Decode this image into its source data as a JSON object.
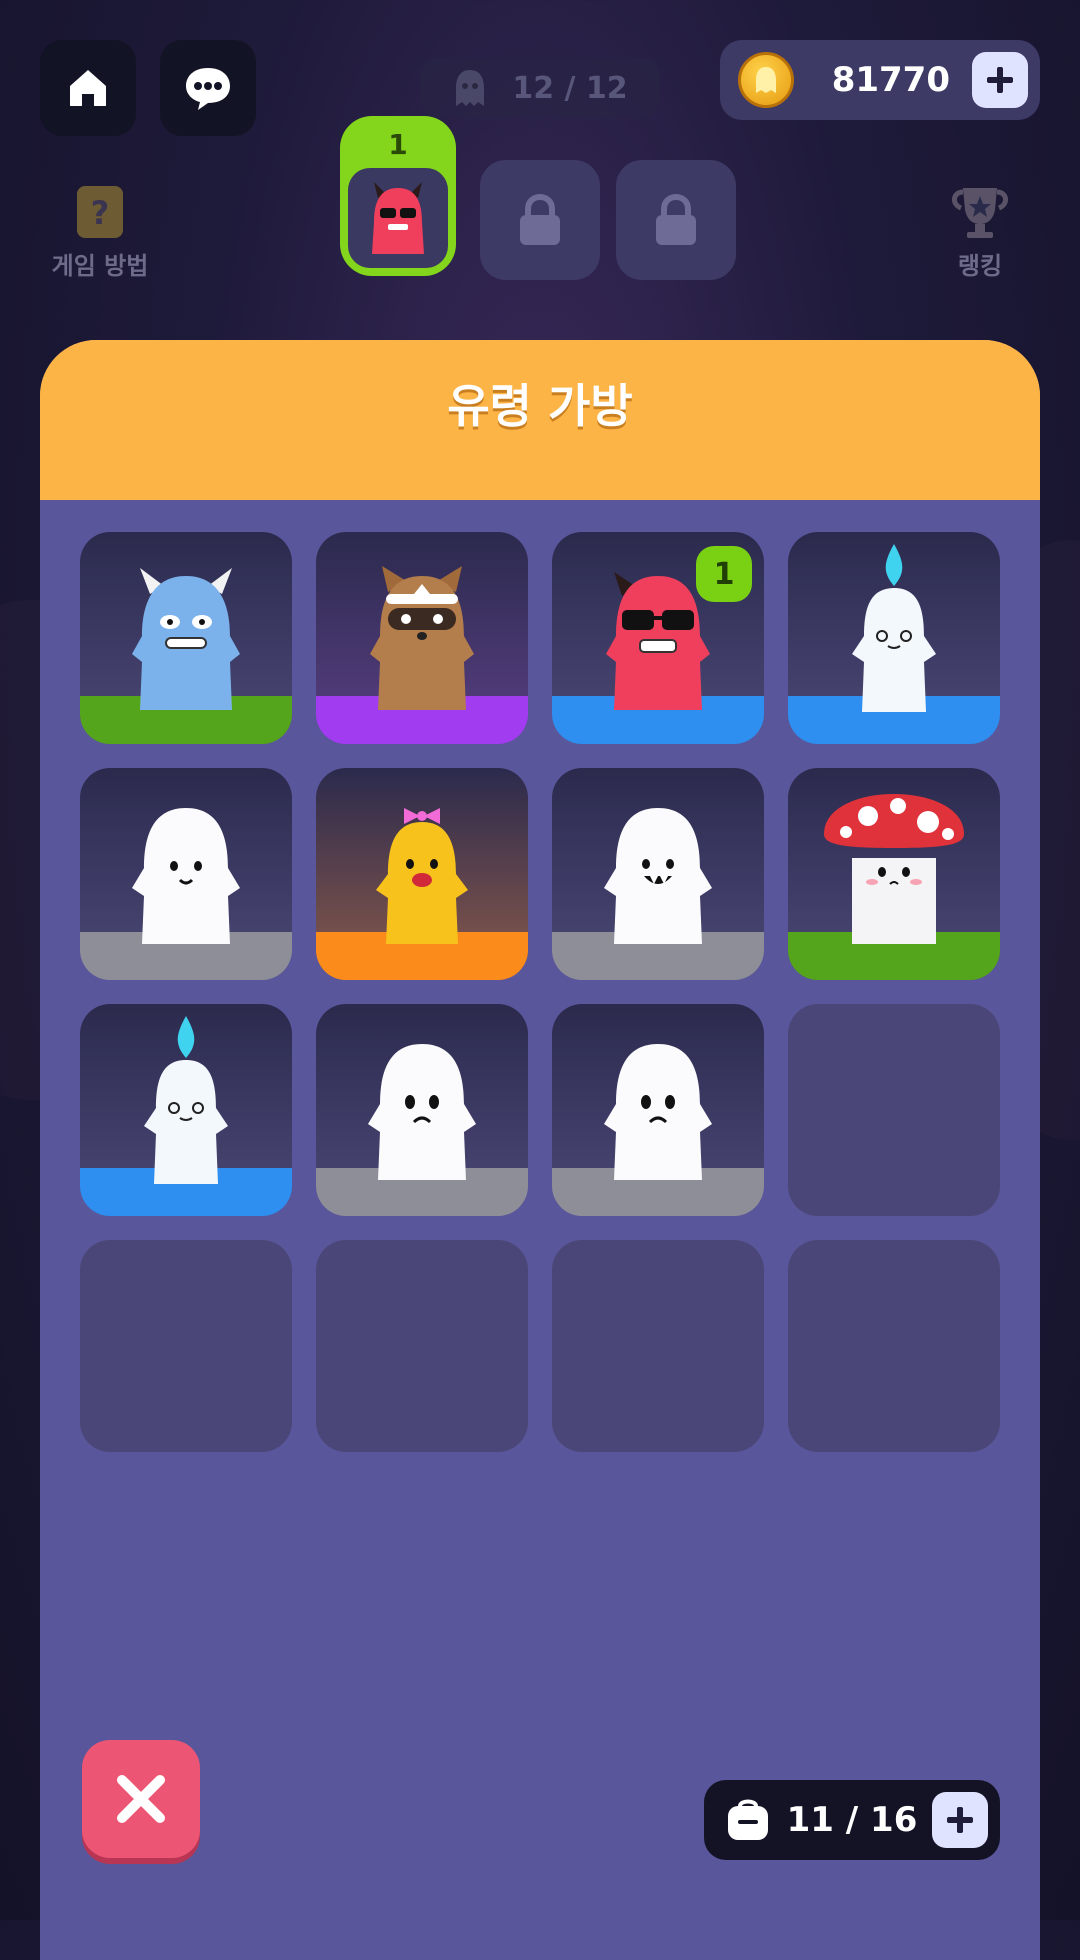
{
  "header": {
    "ghost_count": "12 / 12",
    "coins": "81770"
  },
  "side": {
    "help_label": "게임 방법",
    "ranking_label": "랭킹"
  },
  "slots": {
    "active_count": "1"
  },
  "bag": {
    "title": "유령 가방",
    "capacity": "11 / 16",
    "items": [
      {
        "name": "blue-horned-ghost",
        "floor_color": "#55a51c"
      },
      {
        "name": "raccoon-ghost",
        "floor_color": "#a23cf0"
      },
      {
        "name": "red-devil-sunglasses-ghost",
        "floor_color": "#2e8ff0",
        "badge": "1"
      },
      {
        "name": "candle-ghost",
        "floor_color": "#2e8ff0"
      },
      {
        "name": "white-smile-ghost",
        "floor_color": "#8e8e98"
      },
      {
        "name": "yellow-bow-ghost",
        "floor_color": "#fb8c1c"
      },
      {
        "name": "white-fang-ghost",
        "floor_color": "#8e8e98"
      },
      {
        "name": "mushroom-ghost",
        "floor_color": "#55a51c"
      },
      {
        "name": "candle-ghost",
        "floor_color": "#2e8ff0"
      },
      {
        "name": "white-sad-ghost",
        "floor_color": "#8e8e98"
      },
      {
        "name": "white-sad-ghost",
        "floor_color": "#8e8e98"
      }
    ]
  },
  "colors": {
    "panel": "#5a569b",
    "header_orange": "#fdb447",
    "active_green": "#84d61c",
    "close_red": "#ec5574"
  }
}
